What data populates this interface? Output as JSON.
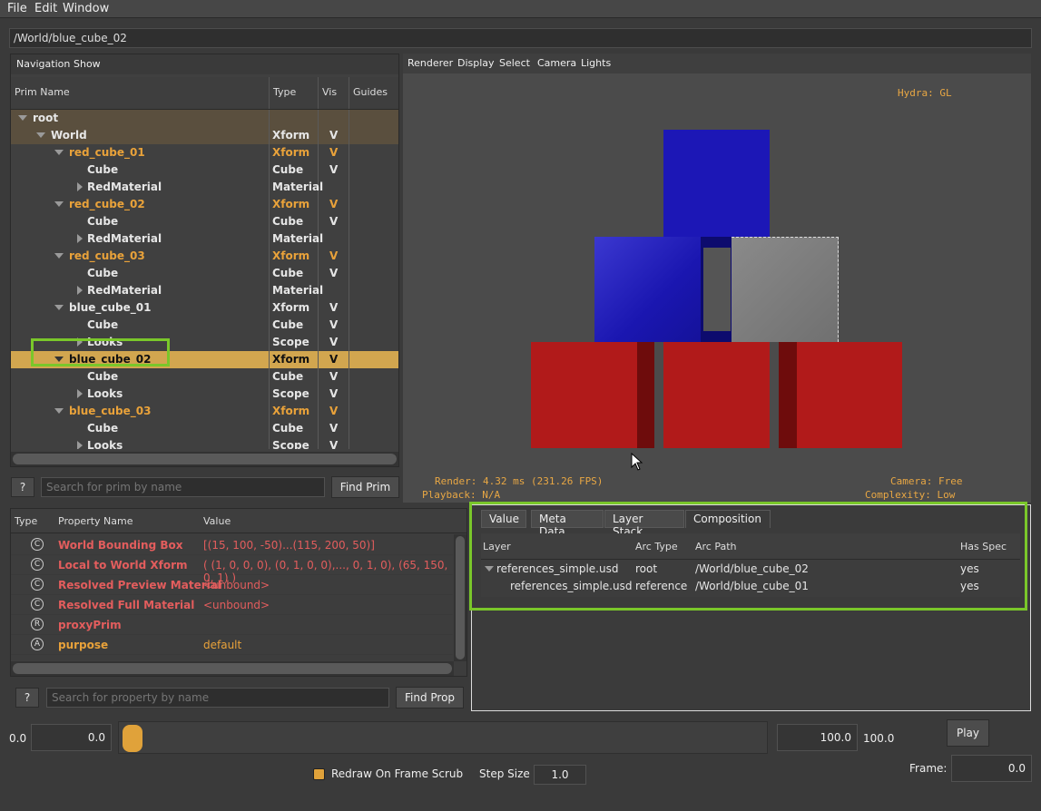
{
  "menu": {
    "file": "File",
    "edit": "Edit",
    "window": "Window"
  },
  "path": "/World/blue_cube_02",
  "nav": {
    "menu": {
      "navigation": "Navigation",
      "show": "Show"
    },
    "columns": {
      "name": "Prim Name",
      "type": "Type",
      "vis": "Vis",
      "guides": "Guides"
    },
    "rows": [
      {
        "name": "root",
        "type": "",
        "vis": "",
        "indent": 0,
        "expand": "down",
        "style": "root"
      },
      {
        "name": "World",
        "type": "Xform",
        "vis": "V",
        "indent": 1,
        "expand": "down",
        "style": "root"
      },
      {
        "name": "red_cube_01",
        "type": "Xform",
        "vis": "V",
        "indent": 2,
        "expand": "down",
        "style": "orange"
      },
      {
        "name": "Cube",
        "type": "Cube",
        "vis": "V",
        "indent": 3,
        "expand": "",
        "style": ""
      },
      {
        "name": "RedMaterial",
        "type": "Material",
        "vis": "",
        "indent": 3,
        "expand": "right",
        "style": ""
      },
      {
        "name": "red_cube_02",
        "type": "Xform",
        "vis": "V",
        "indent": 2,
        "expand": "down",
        "style": "orange"
      },
      {
        "name": "Cube",
        "type": "Cube",
        "vis": "V",
        "indent": 3,
        "expand": "",
        "style": ""
      },
      {
        "name": "RedMaterial",
        "type": "Material",
        "vis": "",
        "indent": 3,
        "expand": "right",
        "style": ""
      },
      {
        "name": "red_cube_03",
        "type": "Xform",
        "vis": "V",
        "indent": 2,
        "expand": "down",
        "style": "orange"
      },
      {
        "name": "Cube",
        "type": "Cube",
        "vis": "V",
        "indent": 3,
        "expand": "",
        "style": ""
      },
      {
        "name": "RedMaterial",
        "type": "Material",
        "vis": "",
        "indent": 3,
        "expand": "right",
        "style": ""
      },
      {
        "name": "blue_cube_01",
        "type": "Xform",
        "vis": "V",
        "indent": 2,
        "expand": "down",
        "style": ""
      },
      {
        "name": "Cube",
        "type": "Cube",
        "vis": "V",
        "indent": 3,
        "expand": "",
        "style": ""
      },
      {
        "name": "Looks",
        "type": "Scope",
        "vis": "V",
        "indent": 3,
        "expand": "right",
        "style": ""
      },
      {
        "name": "blue_cube_02",
        "type": "Xform",
        "vis": "V",
        "indent": 2,
        "expand": "down",
        "style": "selected"
      },
      {
        "name": "Cube",
        "type": "Cube",
        "vis": "V",
        "indent": 3,
        "expand": "",
        "style": ""
      },
      {
        "name": "Looks",
        "type": "Scope",
        "vis": "V",
        "indent": 3,
        "expand": "right",
        "style": ""
      },
      {
        "name": "blue_cube_03",
        "type": "Xform",
        "vis": "V",
        "indent": 2,
        "expand": "down",
        "style": "orange"
      },
      {
        "name": "Cube",
        "type": "Cube",
        "vis": "V",
        "indent": 3,
        "expand": "",
        "style": ""
      },
      {
        "name": "Looks",
        "type": "Scope",
        "vis": "V",
        "indent": 3,
        "expand": "right",
        "style": ""
      }
    ],
    "search_placeholder": "Search for prim by name",
    "help_label": "?",
    "find_label": "Find Prim"
  },
  "props": {
    "columns": {
      "type": "Type",
      "name": "Property Name",
      "value": "Value"
    },
    "rows": [
      {
        "icon": "C",
        "name": "World Bounding Box",
        "value": "[(15, 100, -50)...(115, 200, 50)]",
        "style": "red"
      },
      {
        "icon": "C",
        "name": "Local to World Xform",
        "value": "( (1, 0, 0, 0), (0, 1, 0, 0),..., 0, 1, 0), (65, 150, 0, 1) )",
        "style": "red"
      },
      {
        "icon": "C",
        "name": "Resolved Preview Material",
        "value": "<unbound>",
        "style": "red"
      },
      {
        "icon": "C",
        "name": "Resolved Full Material",
        "value": "<unbound>",
        "style": "red"
      },
      {
        "icon": "R",
        "name": "proxyPrim",
        "value": "",
        "style": "red"
      },
      {
        "icon": "A",
        "name": "purpose",
        "value": "default",
        "style": "orange"
      }
    ],
    "search_placeholder": "Search for property by name",
    "help_label": "?",
    "find_label": "Find Prop"
  },
  "viewport": {
    "menu": {
      "renderer": "Renderer",
      "display": "Display",
      "select": "Select",
      "camera": "Camera",
      "lights": "Lights"
    },
    "hydra": "Hydra: GL",
    "render_stats": "Render: 4.32 ms (231.26 FPS)",
    "playback": "Playback: N/A",
    "camera": "Camera: Free",
    "complexity": "Complexity: Low"
  },
  "composition": {
    "tabs": [
      "Value",
      "Meta Data",
      "Layer Stack",
      "Composition"
    ],
    "active_tab": "Composition",
    "columns": {
      "layer": "Layer",
      "arc_type": "Arc Type",
      "arc_path": "Arc Path",
      "has_spec": "Has Spec"
    },
    "rows": [
      {
        "layer": "references_simple.usd",
        "arc_type": "root",
        "arc_path": "/World/blue_cube_02",
        "has_spec": "yes"
      },
      {
        "layer": "references_simple.usd",
        "arc_type": "reference",
        "arc_path": "/World/blue_cube_01",
        "has_spec": "yes"
      }
    ]
  },
  "timeline": {
    "start_label": "0.0",
    "start_value": "0.0",
    "end_value": "100.0",
    "end_label": "100.0",
    "play_label": "Play",
    "frame_label": "Frame:",
    "frame_value": "0.0",
    "redraw_label": "Redraw On Frame Scrub",
    "redraw_checked": true,
    "step_label": "Step Size",
    "step_value": "1.0"
  },
  "colors": {
    "accent": "#e0a23a",
    "highlight": "#7ac72a",
    "selected_row": "#d2a64f",
    "red_text": "#e35d5d",
    "orange_text": "#e9a23a"
  }
}
